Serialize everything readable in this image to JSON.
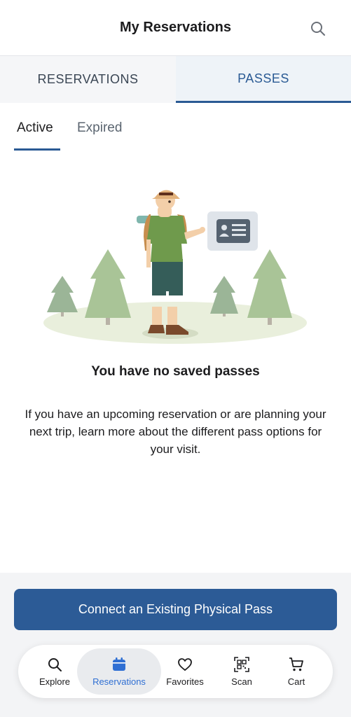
{
  "header": {
    "title": "My Reservations",
    "search_icon": "search-icon"
  },
  "tabs": [
    {
      "label": "RESERVATIONS",
      "active": false
    },
    {
      "label": "PASSES",
      "active": true
    }
  ],
  "subtabs": [
    {
      "label": "Active",
      "active": true
    },
    {
      "label": "Expired",
      "active": false
    }
  ],
  "empty_state": {
    "illustration": "hiker-with-pass-illustration",
    "title": "You have no saved passes",
    "description": "If you have an upcoming reservation or are planning your next trip, learn more about the different pass options for your visit."
  },
  "connect_button": {
    "label": "Connect an Existing Physical Pass"
  },
  "nav": {
    "items": [
      {
        "label": "Explore",
        "icon": "search-icon",
        "active": false
      },
      {
        "label": "Reservations",
        "icon": "calendar-icon",
        "active": true
      },
      {
        "label": "Favorites",
        "icon": "heart-icon",
        "active": false
      },
      {
        "label": "Scan",
        "icon": "qr-scan-icon",
        "active": false
      },
      {
        "label": "Cart",
        "icon": "cart-icon",
        "active": false
      }
    ]
  },
  "colors": {
    "accent": "#2a5a94",
    "button": "#2c5b96",
    "nav_active": "#2f6fd3"
  }
}
